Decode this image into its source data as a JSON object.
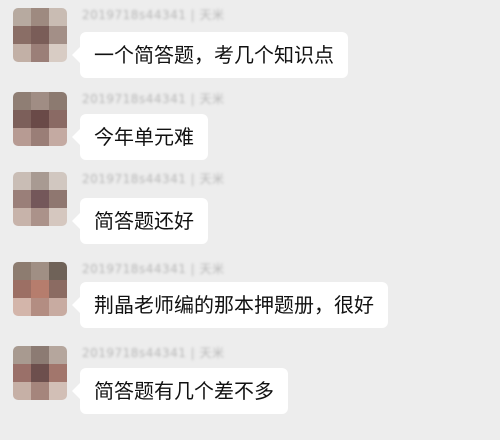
{
  "messages": [
    {
      "sender": "2019718s44341 | 天米",
      "text": "一个简答题，考几个知识点",
      "avatar_colors": [
        "#b7aaa0",
        "#9e8a80",
        "#c9bcb3",
        "#8a6e66",
        "#7a5d58",
        "#a38f87",
        "#c2b0a6",
        "#9b7f78",
        "#d8ccc4"
      ]
    },
    {
      "sender": "2019718s44341 | 天米",
      "text": "今年单元难",
      "avatar_colors": [
        "#8f7e74",
        "#a08d84",
        "#8c7a70",
        "#7c5f5a",
        "#6a4a48",
        "#8a6a64",
        "#b79b93",
        "#9a7e77",
        "#c4aaa2"
      ]
    },
    {
      "sender": "2019718s44341 | 天米",
      "text": "简答题还好",
      "avatar_colors": [
        "#c9bdb5",
        "#a89a92",
        "#d1c7c0",
        "#9a7f79",
        "#74575a",
        "#8f7770",
        "#c7b3aa",
        "#ab928a",
        "#d5c7bf"
      ]
    },
    {
      "sender": "2019718s44341 | 天米",
      "text": "荆晶老师编的那本押题册，很好",
      "avatar_colors": [
        "#8d7c70",
        "#a08f84",
        "#6f6258",
        "#9c6f64",
        "#b67d6d",
        "#8b6b62",
        "#d3b5aa",
        "#b38d82",
        "#c8aba1"
      ]
    },
    {
      "sender": "2019718s44341 | 天米",
      "text": "简答题有几个差不多",
      "avatar_colors": [
        "#a89a90",
        "#8c7b73",
        "#b5a69d",
        "#9a7069",
        "#6d4f4d",
        "#a2766c",
        "#c6b0a6",
        "#a5857c",
        "#d2bfb6"
      ]
    }
  ]
}
